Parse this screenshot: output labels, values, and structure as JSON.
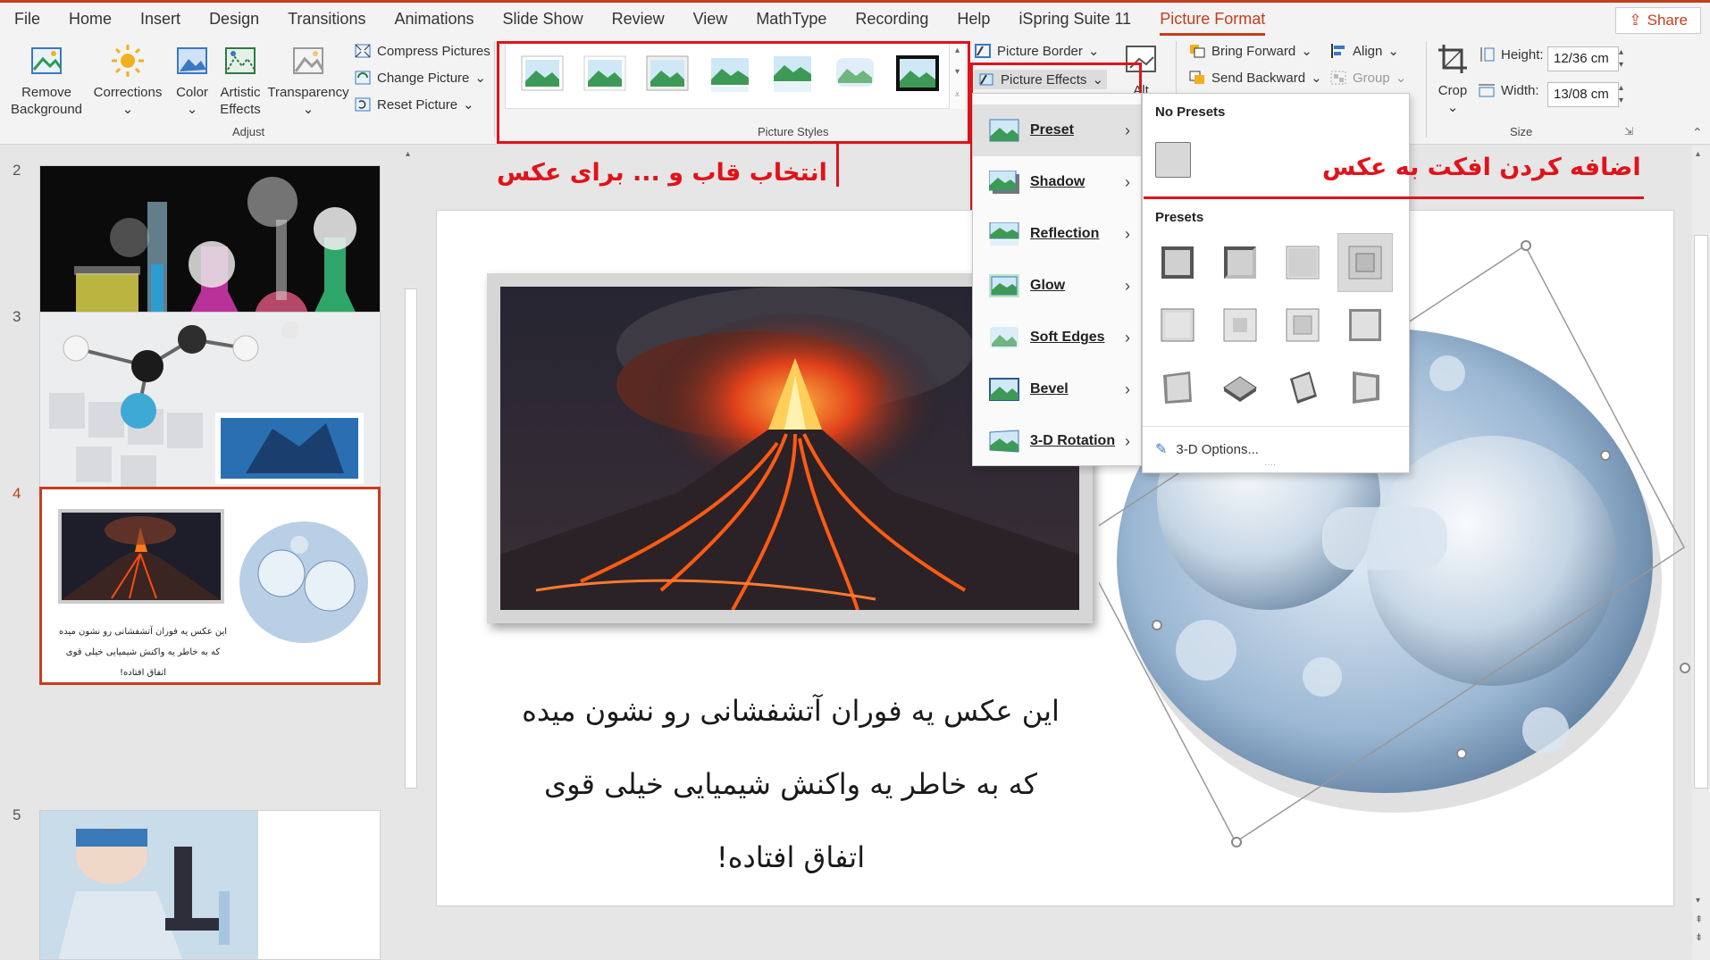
{
  "menubar": {
    "items": [
      "File",
      "Home",
      "Insert",
      "Design",
      "Transitions",
      "Animations",
      "Slide Show",
      "Review",
      "View",
      "MathType",
      "Recording",
      "Help",
      "iSpring Suite 11",
      "Picture Format"
    ],
    "active": "Picture Format",
    "share_label": "Share"
  },
  "ribbon": {
    "adjust": {
      "remove_background": "Remove Background",
      "corrections": "Corrections",
      "color": "Color",
      "artistic_effects": "Artistic Effects",
      "transparency": "Transparency",
      "compress": "Compress Pictures",
      "change": "Change Picture",
      "reset": "Reset Picture",
      "group_label": "Adjust"
    },
    "styles": {
      "group_label": "Picture Styles",
      "picture_border": "Picture Border",
      "picture_effects": "Picture Effects",
      "alt_text": "Alt"
    },
    "arrange": {
      "bring_forward": "Bring Forward",
      "send_backward": "Send Backward",
      "align": "Align",
      "group": "Group"
    },
    "size": {
      "crop": "Crop",
      "height_label": "Height:",
      "height_value": "12/36 cm",
      "width_label": "Width:",
      "width_value": "13/08 cm",
      "group_label": "Size"
    }
  },
  "slides": {
    "numbers": [
      "2",
      "3",
      "4",
      "5"
    ],
    "active": "4",
    "thumb4_text": "این عکس یه فوران آتشفشانی رو نشون میده که به خاطر یه واکنش شیمیایی خیلی قوی اتفاق افتاده!"
  },
  "slide_text": {
    "line1": "این عکس یه فوران آتشفشانی رو نشون میده",
    "line2": "که به خاطر یه واکنش شیمیایی خیلی قوی",
    "line3": "اتفاق افتاده!"
  },
  "effects_menu": {
    "items": [
      "Preset",
      "Shadow",
      "Reflection",
      "Glow",
      "Soft Edges",
      "Bevel",
      "3-D Rotation"
    ],
    "selected": "Preset"
  },
  "preset_menu": {
    "no_presets": "No Presets",
    "presets": "Presets",
    "options": "3-D Options..."
  },
  "annotations": {
    "right": "اضافه کردن افکت به عکس",
    "left": "انتخاب قاب و ... برای عکس"
  },
  "colors": {
    "accent": "#c43e1c",
    "annotation_red": "#e0131a"
  }
}
